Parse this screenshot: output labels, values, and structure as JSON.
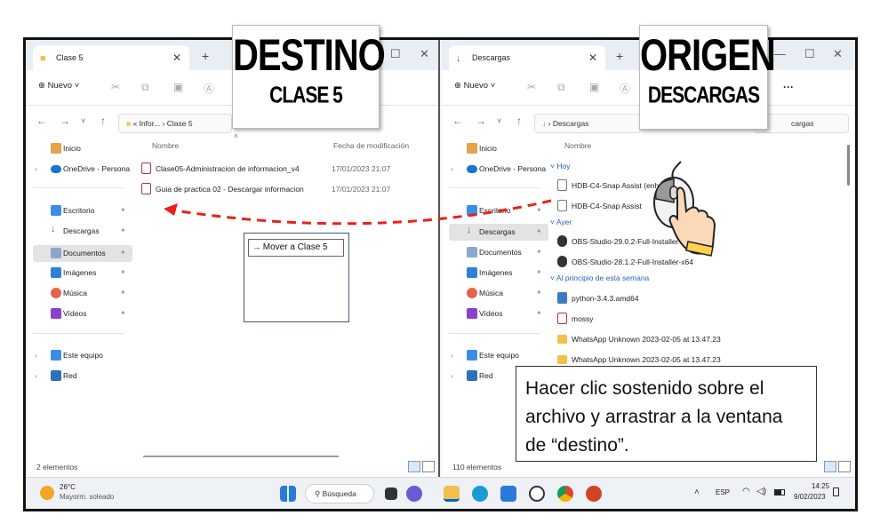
{
  "left_window": {
    "tab_title": "Clase 5",
    "new_label": "Nuevo",
    "breadcrumb": [
      "Infor...",
      "Clase 5"
    ],
    "col_name": "Nombre",
    "col_date": "Fecha de modificación",
    "files": [
      {
        "name": "Clase05-Administracion de informacion_v4",
        "date": "17/01/2023 21:07"
      },
      {
        "name": "Guia de practica 02 - Descargar informacion",
        "date": "17/01/2023 21:07"
      }
    ],
    "status": "2 elementos"
  },
  "right_window": {
    "tab_title": "Descargas",
    "new_label": "Nuevo",
    "breadcrumb": "Descargas",
    "search_fragment": "cargas",
    "col_name": "Nombre",
    "groups": [
      {
        "label": "Hoy",
        "files": [
          "HDB-C4-Snap Assist (enhanced)",
          "HDB-C4-Snap Assist"
        ]
      },
      {
        "label": "Ayer",
        "files": [
          "OBS-Studio-29.0.2-Full-Installer-x64",
          "OBS-Studio-28.1.2-Full-Installer-x64"
        ]
      },
      {
        "label": "Al principio de esta semana",
        "files": [
          "python-3.4.3.amd64",
          "mossy",
          "WhatsApp Unknown 2023-02-05 at 13.47.23",
          "WhatsApp Unknown 2023-02-05 at 13.47.23"
        ]
      }
    ],
    "status": "110 elementos"
  },
  "sidebar": {
    "items": [
      "Inicio",
      "OneDrive - Persona",
      "Escritorio",
      "Descargas",
      "Documentos",
      "Imágenes",
      "Música",
      "Vídeos",
      "Este equipo",
      "Red"
    ]
  },
  "overlays": {
    "destino_title": "DESTINO",
    "destino_sub": "CLASE 5",
    "origen_title": "ORIGEN",
    "origen_sub": "DESCARGAS",
    "drag_tooltip": "Mover a Clase 5",
    "instruction": "Hacer clic sostenido sobre el archivo y arrastrar a la ventana de “destino”."
  },
  "taskbar": {
    "weather_temp": "26°C",
    "weather_desc": "Mayorm. soleado",
    "search_label": "Búsqueda",
    "lang": "ESP",
    "time": "14:25",
    "date": "9/02/2023"
  },
  "colors": {
    "accent": "#0067c0",
    "arrow": "#e8211b",
    "folder": "#f2c04c"
  }
}
